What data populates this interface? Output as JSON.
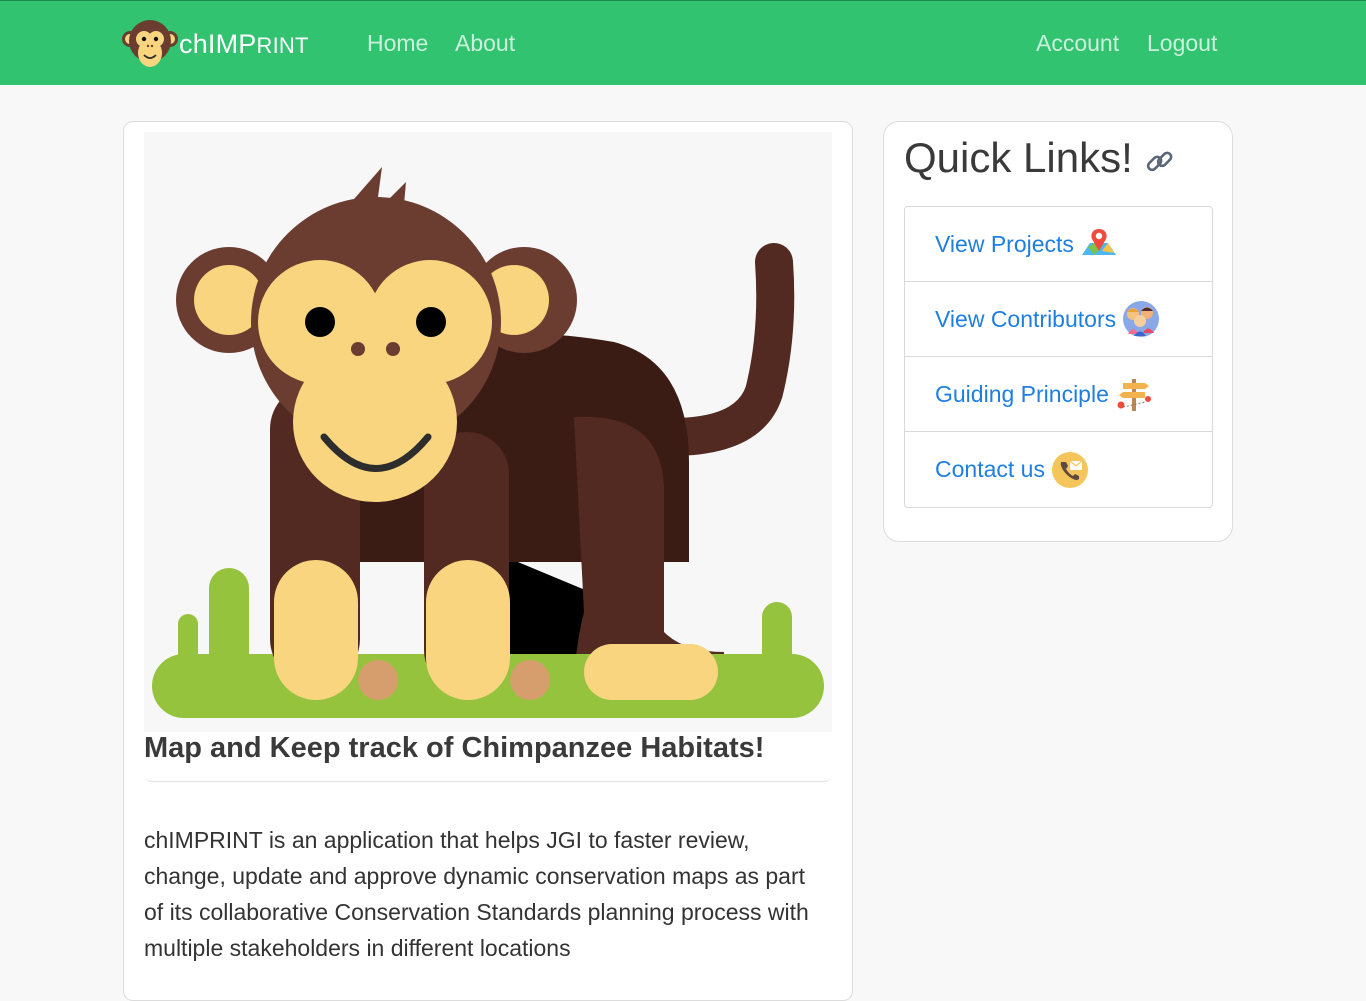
{
  "navbar": {
    "brand_main": "chIMP",
    "brand_small": "RINT",
    "links": [
      "Home",
      "About"
    ],
    "right_links": [
      "Account",
      "Logout"
    ]
  },
  "hero": {
    "caption": "Map and Keep track of Chimpanzee Habitats!"
  },
  "description": "chIMPRINT is an application that helps JGI to faster review, change, update and approve dynamic conservation maps as part of its collaborative Conservation Standards planning process with multiple stakeholders in different locations",
  "quick_links": {
    "title": "Quick Links!",
    "title_icon": "link-icon",
    "items": [
      {
        "label": "View Projects",
        "icon": "map-pin-icon"
      },
      {
        "label": "View Contributors",
        "icon": "people-icon"
      },
      {
        "label": "Guiding Principle",
        "icon": "signpost-icon"
      },
      {
        "label": "Contact us",
        "icon": "phone-icon"
      }
    ]
  },
  "colors": {
    "navbar": "#31c370",
    "link": "#1f7fe0",
    "chimp_brown": "#6b3d31",
    "chimp_face": "#f8d57e",
    "grass": "#96c33e"
  }
}
